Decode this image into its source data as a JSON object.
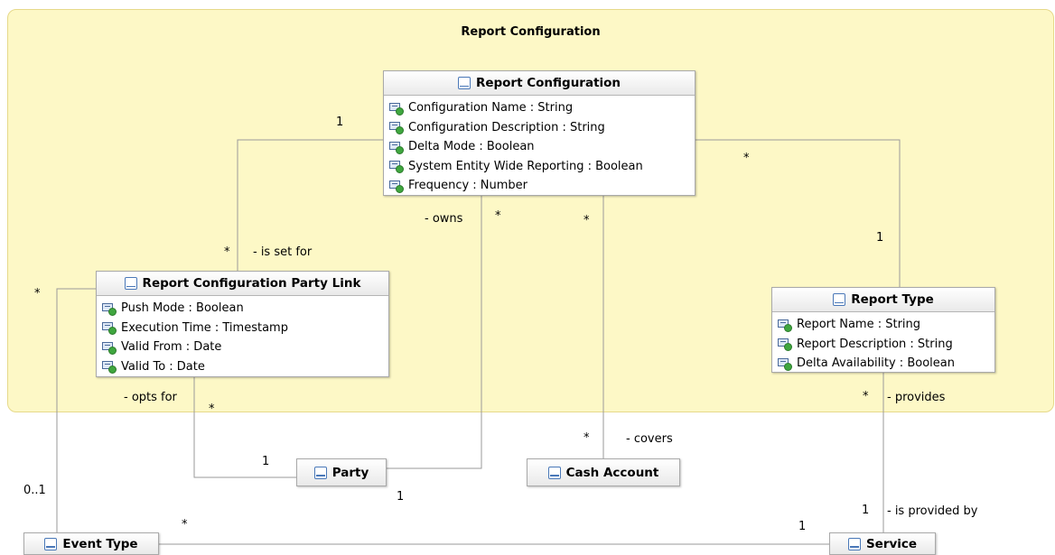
{
  "package": {
    "title": "Report Configuration"
  },
  "classes": {
    "report_configuration": {
      "name": "Report Configuration",
      "attributes": [
        "Configuration Name : String",
        "Configuration Description : String",
        "Delta Mode : Boolean",
        "System Entity Wide Reporting : Boolean",
        "Frequency : Number"
      ]
    },
    "party_link": {
      "name": "Report Configuration Party Link",
      "attributes": [
        "Push Mode : Boolean",
        "Execution Time : Timestamp",
        "Valid From : Date",
        "Valid To : Date"
      ]
    },
    "report_type": {
      "name": "Report Type",
      "attributes": [
        "Report Name : String",
        "Report Description : String",
        "Delta Availability : Boolean"
      ]
    },
    "party": {
      "name": "Party"
    },
    "cash_account": {
      "name": "Cash Account"
    },
    "event_type": {
      "name": "Event Type"
    },
    "service": {
      "name": "Service"
    }
  },
  "labels": {
    "rc_link_one": "1",
    "link_star_top": "*",
    "is_set_for": "- is set for",
    "owns": "- owns",
    "owns_star": "*",
    "covers_star_top": "*",
    "rc_type_star": "*",
    "type_one": "1",
    "link_star_left": "*",
    "opts_for": "- opts for",
    "opts_star": "*",
    "party_one_left": "1",
    "party_one_bottom": "1",
    "cash_star": "*",
    "covers": "- covers",
    "provides_star": "*",
    "provides": "- provides",
    "event_mult": "0..1",
    "event_star": "*",
    "service_one_left": "1",
    "service_one_top": "1",
    "is_provided_by": "- is provided by"
  }
}
